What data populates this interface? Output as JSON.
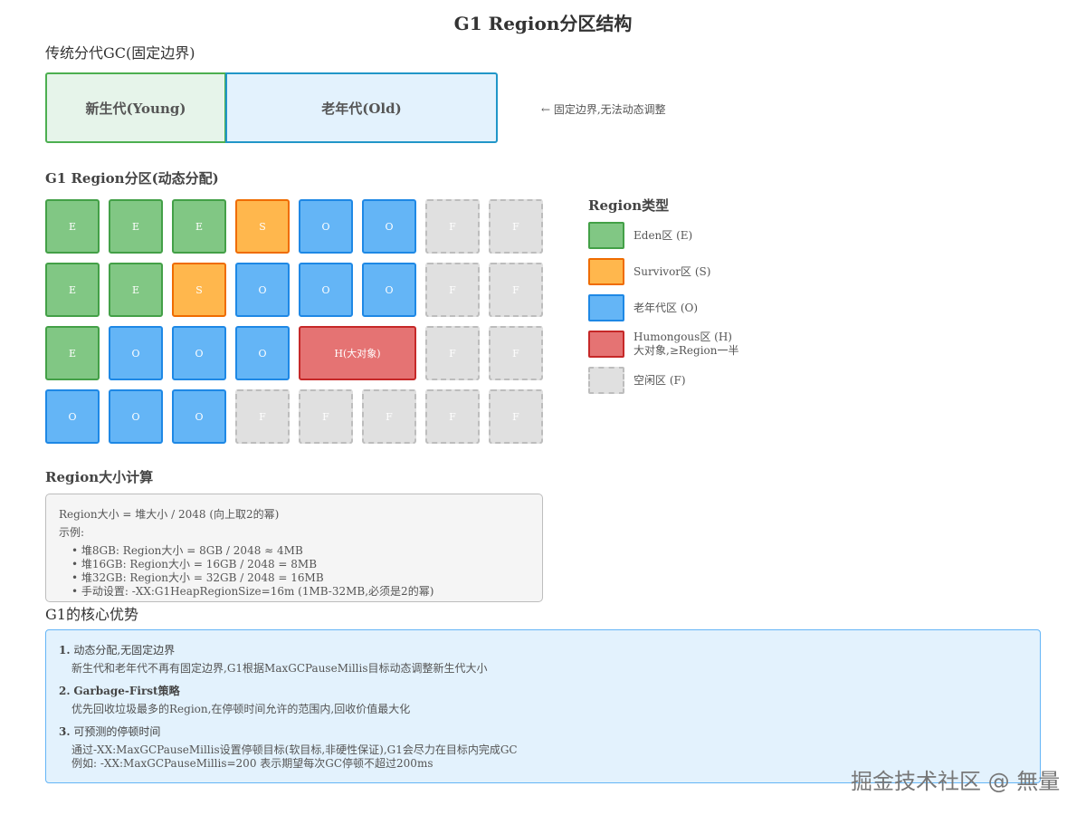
{
  "title": "G1 Region分区结构",
  "traditional": {
    "heading": "传统分代GC(固定边界)",
    "young_label": "新生代(Young)",
    "old_label": "老年代(Old)",
    "note": "← 固定边界,无法动态调整"
  },
  "g1": {
    "heading": "G1 Region分区(动态分配)",
    "rows": [
      [
        {
          "t": "E",
          "label": "E"
        },
        {
          "t": "E",
          "label": "E"
        },
        {
          "t": "E",
          "label": "E"
        },
        {
          "t": "S",
          "label": "S"
        },
        {
          "t": "O",
          "label": "O"
        },
        {
          "t": "O",
          "label": "O"
        },
        {
          "t": "F",
          "label": "F"
        },
        {
          "t": "F",
          "label": "F"
        }
      ],
      [
        {
          "t": "E",
          "label": "E"
        },
        {
          "t": "E",
          "label": "E"
        },
        {
          "t": "S",
          "label": "S"
        },
        {
          "t": "O",
          "label": "O"
        },
        {
          "t": "O",
          "label": "O"
        },
        {
          "t": "O",
          "label": "O"
        },
        {
          "t": "F",
          "label": "F"
        },
        {
          "t": "F",
          "label": "F"
        }
      ],
      [
        {
          "t": "E",
          "label": "E"
        },
        {
          "t": "O",
          "label": "O"
        },
        {
          "t": "O",
          "label": "O"
        },
        {
          "t": "O",
          "label": "O"
        },
        {
          "t": "H",
          "label": "H(大对象)",
          "span": 2
        },
        {
          "t": "F",
          "label": "F"
        },
        {
          "t": "F",
          "label": "F"
        }
      ],
      [
        {
          "t": "O",
          "label": "O"
        },
        {
          "t": "O",
          "label": "O"
        },
        {
          "t": "O",
          "label": "O"
        },
        {
          "t": "F",
          "label": "F"
        },
        {
          "t": "F",
          "label": "F"
        },
        {
          "t": "F",
          "label": "F"
        },
        {
          "t": "F",
          "label": "F"
        },
        {
          "t": "F",
          "label": "F"
        }
      ]
    ]
  },
  "legend": {
    "title": "Region类型",
    "items": [
      {
        "t": "E",
        "line1": "Eden区 (E)",
        "line2": ""
      },
      {
        "t": "S",
        "line1": "Survivor区 (S)",
        "line2": ""
      },
      {
        "t": "O",
        "line1": "老年代区 (O)",
        "line2": ""
      },
      {
        "t": "H",
        "line1": "Humongous区 (H)",
        "line2": "大对象,≥Region一半"
      },
      {
        "t": "F",
        "line1": "空闲区 (F)",
        "line2": ""
      }
    ]
  },
  "calc": {
    "heading": "Region大小计算",
    "formula": "Region大小 = 堆大小 / 2048 (向上取2的幂)",
    "example_label": "示例:",
    "examples": [
      "• 堆8GB: Region大小 = 8GB / 2048 ≈ 4MB",
      "• 堆16GB: Region大小 = 16GB / 2048 = 8MB",
      "• 堆32GB: Region大小 = 32GB / 2048 = 16MB",
      "• 手动设置: -XX:G1HeapRegionSize=16m (1MB-32MB,必须是2的幂)"
    ]
  },
  "advantages": {
    "heading": "G1的核心优势",
    "items": [
      {
        "num": "1.",
        "title": "动态分配,无固定边界",
        "lines": [
          "新生代和老年代不再有固定边界,G1根据MaxGCPauseMillis目标动态调整新生代大小"
        ]
      },
      {
        "num": "2.",
        "title": "Garbage-First策略",
        "lines": [
          "优先回收垃圾最多的Region,在停顿时间允许的范围内,回收价值最大化"
        ]
      },
      {
        "num": "3.",
        "title": "可预测的停顿时间",
        "lines": [
          "通过-XX:MaxGCPauseMillis设置停顿目标(软目标,非硬性保证),G1会尽力在目标内完成GC",
          "例如: -XX:MaxGCPauseMillis=200 表示期望每次GC停顿不超过200ms"
        ]
      }
    ]
  },
  "watermark": "掘金技术社区 @ 無量"
}
